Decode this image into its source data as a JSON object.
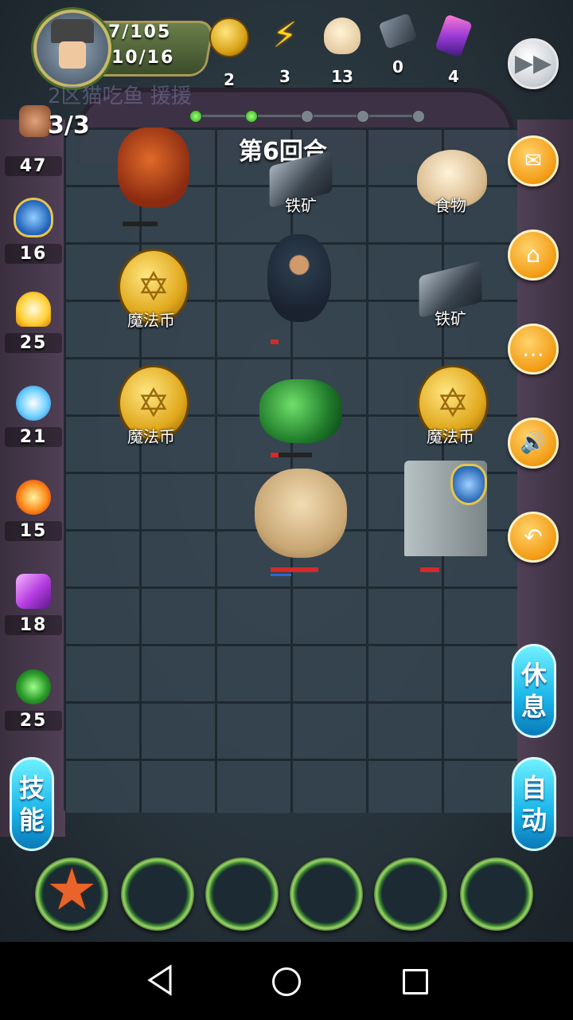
{
  "player": {
    "hp": "7/105",
    "level": "10/16",
    "attacks": "3/3",
    "ghost_text": "2区猫吃鱼 援援"
  },
  "resources": [
    {
      "name": "magic-coin",
      "value": "2"
    },
    {
      "name": "energy",
      "value": "3"
    },
    {
      "name": "food",
      "value": "13"
    },
    {
      "name": "iron-ore",
      "value": "0"
    },
    {
      "name": "gem",
      "value": "4"
    }
  ],
  "stats": [
    {
      "name": "attack",
      "icon": "fist-icon",
      "value": "47"
    },
    {
      "name": "defense",
      "icon": "shield-icon",
      "value": "16"
    },
    {
      "name": "holy",
      "icon": "holy-flame-icon",
      "value": "25"
    },
    {
      "name": "water",
      "icon": "wave-icon",
      "value": "21"
    },
    {
      "name": "fire",
      "icon": "fire-icon",
      "value": "15"
    },
    {
      "name": "lightning",
      "icon": "lightning-icon",
      "value": "18"
    },
    {
      "name": "poison",
      "icon": "serpent-icon",
      "value": "25"
    }
  ],
  "round": {
    "label": "第6回合",
    "dots_active": 2,
    "dots_total": 5
  },
  "board": {
    "iron1": "铁矿",
    "food": "食物",
    "coin1": "魔法币",
    "iron2": "铁矿",
    "coin2": "魔法币",
    "coin3": "魔法币"
  },
  "buttons": {
    "rest": "休息",
    "auto": "自动",
    "skill": "技能"
  },
  "colors": {
    "accent": "#f39b14",
    "pill": "#18b3e8"
  }
}
